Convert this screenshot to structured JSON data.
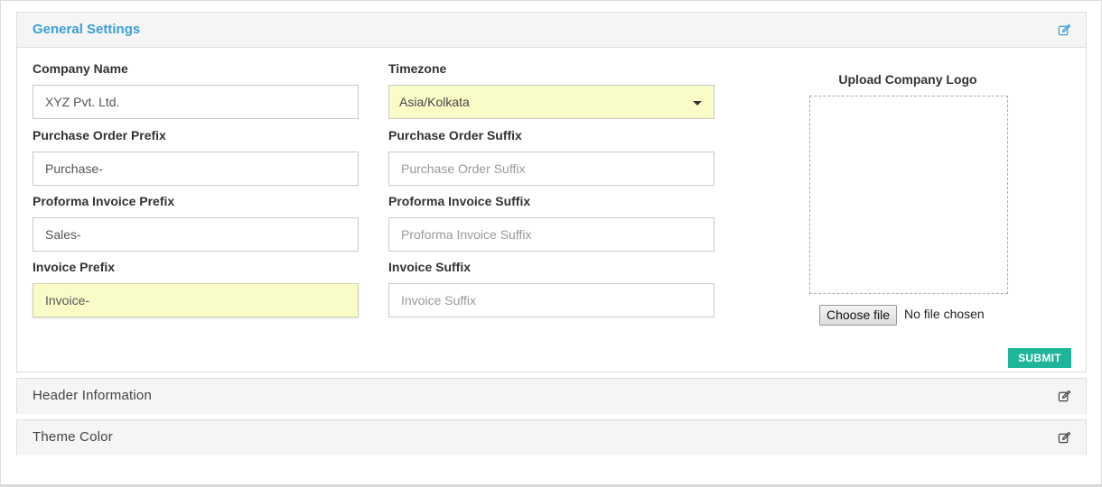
{
  "panels": {
    "general": {
      "title": "General Settings",
      "icon": "edit-icon"
    },
    "header_info": {
      "title": "Header Information",
      "icon": "edit-icon"
    },
    "theme_color": {
      "title": "Theme Color",
      "icon": "edit-icon"
    }
  },
  "form": {
    "company_name": {
      "label": "Company Name",
      "value": "XYZ Pvt. Ltd.",
      "placeholder": ""
    },
    "timezone": {
      "label": "Timezone",
      "selected": "Asia/Kolkata",
      "icon": "caret-down-icon"
    },
    "po_prefix": {
      "label": "Purchase Order Prefix",
      "value": "Purchase-",
      "placeholder": ""
    },
    "po_suffix": {
      "label": "Purchase Order Suffix",
      "value": "",
      "placeholder": "Purchase Order Suffix"
    },
    "pi_prefix": {
      "label": "Proforma Invoice Prefix",
      "value": "Sales-",
      "placeholder": ""
    },
    "pi_suffix": {
      "label": "Proforma Invoice Suffix",
      "value": "",
      "placeholder": "Proforma Invoice Suffix"
    },
    "inv_prefix": {
      "label": "Invoice Prefix",
      "value": "Invoice-",
      "placeholder": ""
    },
    "inv_suffix": {
      "label": "Invoice Suffix",
      "value": "",
      "placeholder": "Invoice Suffix"
    }
  },
  "upload": {
    "label": "Upload Company Logo",
    "button": "Choose file",
    "status": "No file chosen"
  },
  "submit_label": "SUBMIT",
  "colors": {
    "accent_title": "#3a9fd6",
    "submit_bg": "#1fb59a",
    "highlight_bg": "#fafcc8"
  }
}
